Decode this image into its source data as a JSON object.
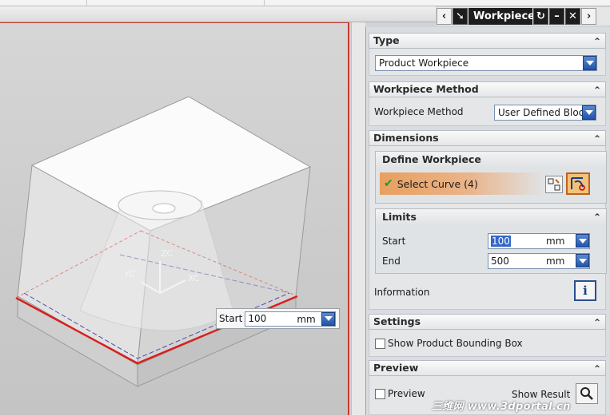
{
  "dialog": {
    "title": "Workpiece",
    "buttons": [
      "back-icon",
      "arrow-icon",
      "reset-icon",
      "minimize-icon",
      "close-icon",
      "next-icon"
    ]
  },
  "type": {
    "header": "Type",
    "value": "Product Workpiece"
  },
  "method": {
    "header": "Workpiece Method",
    "label": "Workpiece Method",
    "value": "User Defined Block"
  },
  "dimensions": {
    "header": "Dimensions",
    "define": {
      "header": "Define Workpiece",
      "select_label": "Select Curve (4)"
    },
    "limits": {
      "header": "Limits",
      "start_label": "Start",
      "start_value": "100",
      "start_unit": "mm",
      "end_label": "End",
      "end_value": "500",
      "end_unit": "mm"
    },
    "information_label": "Information"
  },
  "settings": {
    "header": "Settings",
    "checkbox_label": "Show Product Bounding Box"
  },
  "preview": {
    "header": "Preview",
    "checkbox_label": "Preview",
    "show_result_label": "Show Result"
  },
  "viewport": {
    "axis_labels": {
      "zc": "ZC",
      "yc": "YC",
      "xc": "XC"
    },
    "tooltip": {
      "label": "Start",
      "value": "100",
      "unit": "mm"
    }
  },
  "watermark": "三维网 www.3dportal.cn"
}
